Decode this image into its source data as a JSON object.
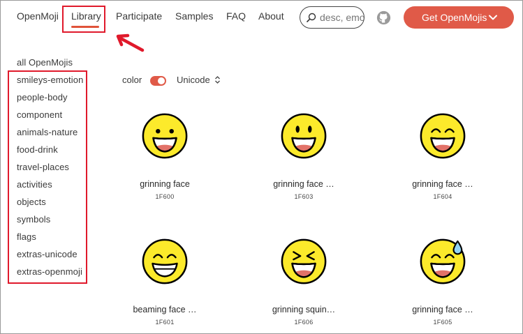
{
  "header": {
    "brand": "OpenMoji",
    "nav": [
      {
        "label": "Library",
        "active": true
      },
      {
        "label": "Participate"
      },
      {
        "label": "Samples"
      },
      {
        "label": "FAQ"
      },
      {
        "label": "About"
      }
    ],
    "search": {
      "placeholder": "desc, emoji"
    },
    "cta_label": "Get OpenMojis",
    "accent_color": "#e05a48",
    "icons": [
      "search-icon",
      "github-icon",
      "chevron-down-icon"
    ]
  },
  "sidebar": {
    "items": [
      {
        "label": "all OpenMojis"
      },
      {
        "label": "smileys-emotion"
      },
      {
        "label": "people-body"
      },
      {
        "label": "component"
      },
      {
        "label": "animals-nature"
      },
      {
        "label": "food-drink"
      },
      {
        "label": "travel-places"
      },
      {
        "label": "activities"
      },
      {
        "label": "objects"
      },
      {
        "label": "symbols"
      },
      {
        "label": "flags"
      },
      {
        "label": "extras-unicode"
      },
      {
        "label": "extras-openmoji"
      }
    ]
  },
  "filters": {
    "color_label": "color",
    "color_enabled": true,
    "sort_label": "Unicode"
  },
  "emojis": [
    {
      "name": "grinning face",
      "code": "1F600",
      "face": "grinning"
    },
    {
      "name": "grinning face …",
      "code": "1F603",
      "face": "big-eyes"
    },
    {
      "name": "grinning face …",
      "code": "1F604",
      "face": "smiling-eyes"
    },
    {
      "name": "beaming face …",
      "code": "1F601",
      "face": "beaming"
    },
    {
      "name": "grinning squin…",
      "code": "1F606",
      "face": "squinting"
    },
    {
      "name": "grinning face …",
      "code": "1F605",
      "face": "sweat"
    }
  ],
  "annotation_color": "#e0192b"
}
